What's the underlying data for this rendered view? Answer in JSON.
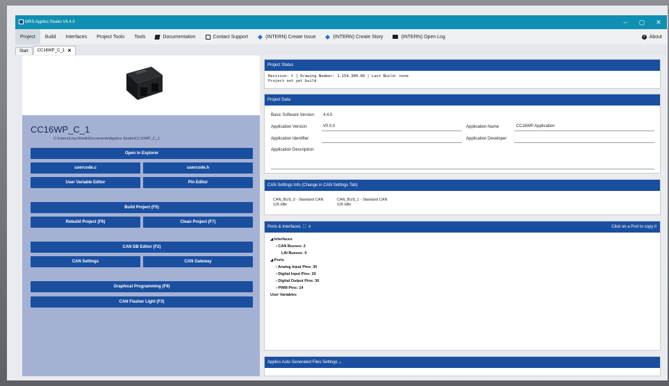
{
  "window": {
    "title": "MRS Applics Studio V4.4.0",
    "controls": [
      "–",
      "▢",
      "✕"
    ]
  },
  "menu": {
    "items": [
      {
        "label": "Project",
        "icon": ""
      },
      {
        "label": "Build",
        "icon": ""
      },
      {
        "label": "Interfaces",
        "icon": ""
      },
      {
        "label": "Project Tools",
        "icon": ""
      },
      {
        "label": "Tools",
        "icon": ""
      },
      {
        "label": "Documentation",
        "icon": "book-icon"
      },
      {
        "label": "Contact Support",
        "icon": "square-icon"
      },
      {
        "label": "(INTERN) Create Issue",
        "icon": "diamond-icon"
      },
      {
        "label": "(INTERN) Create Story",
        "icon": "diamond-icon"
      },
      {
        "label": "(INTERN) Open Log",
        "icon": "folder-icon"
      }
    ],
    "about": "About"
  },
  "tabs": [
    {
      "label": "Start"
    },
    {
      "label": "CC16WP_C_1",
      "close": "✕"
    }
  ],
  "project": {
    "name": "CC16WP_C_1",
    "path": "C:\\Users\\Lisa.Woelk\\Documents\\Applics Studio\\CC16WP_C_1"
  },
  "buttons": {
    "open_explorer": "Open in Explorer",
    "usercode_c": "usercode.c",
    "usercode_h": "usercode.h",
    "user_var_editor": "User Variable Editor",
    "pin_editor": "Pin Editor",
    "build": "Build Project (F5)",
    "rebuild": "Rebuild Project (F6)",
    "clean": "Clean Project (F7)",
    "can_db": "CAN DB Editor (F2)",
    "can_settings": "CAN Settings",
    "can_gateway": "CAN Gateway",
    "graphical": "Graphical Programming (F9)",
    "flasher": "CAN Flasher Light (F3)"
  },
  "status": {
    "title": "Project Status",
    "line1": "Revision: C  |  Drawing Number: 1.154.300.00  |  Last Build: none",
    "line2": "Project not yet build"
  },
  "data_panel": {
    "title": "Project Data",
    "bsv_label": "Basic Software Version:",
    "bsv_value": "4.4.0",
    "app_version_label": "Application Version:",
    "app_version_value": "V0.0.0",
    "app_name_label": "Application Name",
    "app_name_value": "CC16WP Application",
    "app_id_label": "Application Identifier:",
    "app_dev_label": "Application Developer",
    "app_desc_label": "Application Description:"
  },
  "can_panel": {
    "title": "CAN Settings Info (Change in CAN Settings Tab)",
    "bus0_name": "CAN_BUS_0 - Standard CAN",
    "bus0_rate": "125 kBit",
    "bus1_name": "CAN_BUS_1 - Standard CAN",
    "bus1_rate": "125 kBit"
  },
  "ports_panel": {
    "title": "Ports & Interfaces",
    "hint": "Click on a Port to copy it",
    "interfaces": "Interfaces",
    "can_busses": "CAN Busses: 2",
    "lin_busses": "LIN Busses: 0",
    "ports": "Ports",
    "analog": "Analog Input Pins: 35",
    "digital_in": "Digital Input Pins: 20",
    "digital_out": "Digital Output Pins: 30",
    "pwm": "PWM Pins: 14",
    "user_vars": "User Variables"
  },
  "autogen_panel": {
    "title": "Applics Auto Generated Files Settings"
  },
  "colors": {
    "accent": "#1a4fa0",
    "titlebar": "#0f8fb1",
    "sidebar": "#a5b1d3"
  }
}
